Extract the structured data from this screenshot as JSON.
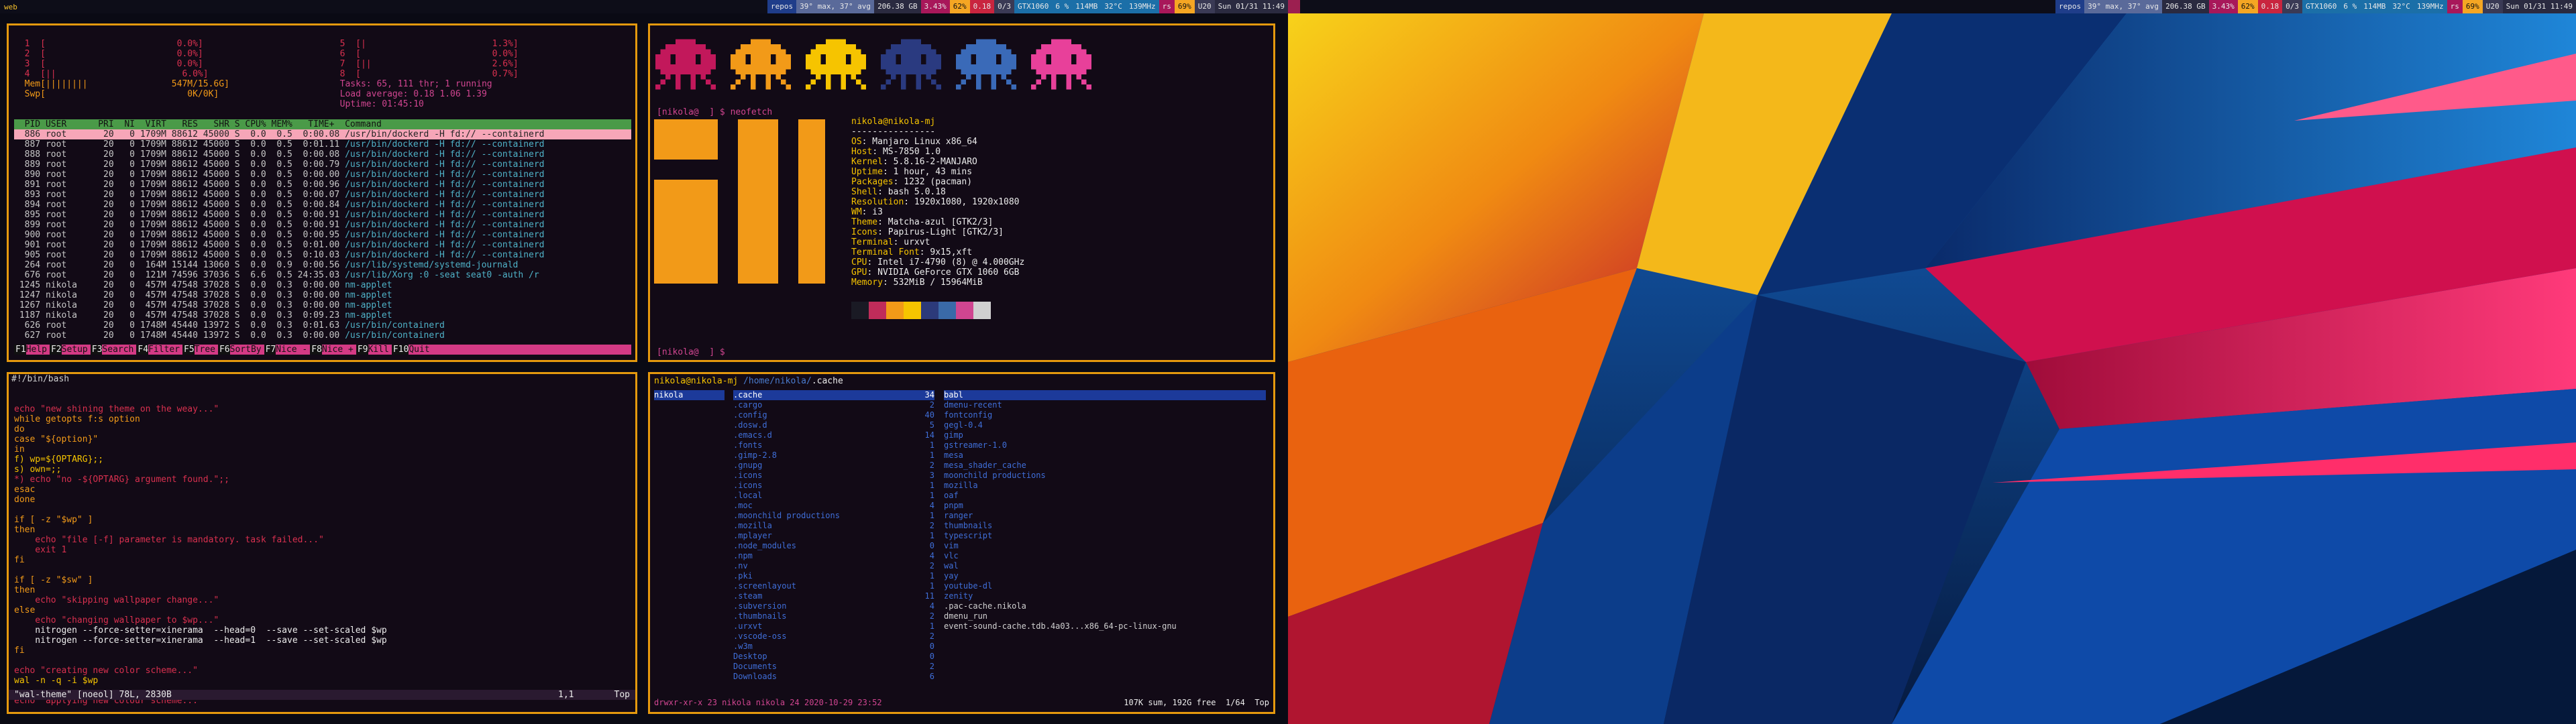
{
  "topbar_left": {
    "workspace": "web",
    "blocks": [
      "repos",
      "39° max, 37° avg",
      "206.38 GB",
      "3.43%",
      "62%",
      "0.18",
      "0/3",
      "GTX1060",
      "6 %",
      "114MB",
      "32°C",
      "139MHz",
      "rs",
      "69%",
      "U20",
      "Sun 01/31 11:49"
    ]
  },
  "topbar_right": {
    "blocks": [
      "repos",
      "39° max, 37° avg",
      "206.38 GB",
      "3.43%",
      "62%",
      "0.18",
      "0/3",
      "GTX1060",
      "6 %",
      "114MB",
      "32°C",
      "139MHz",
      "rs",
      "69%",
      "U20",
      "Sun 01/31 11:49"
    ]
  },
  "htop": {
    "cpu_left": [
      "  1  [                         0.0%]",
      "  2  [                         0.0%]",
      "  3  [                         0.0%]",
      "  4  [||                        6.0%]"
    ],
    "mem": "  Mem[||||||||                547M/15.6G]",
    "swp": "  Swp[                           0K/0K]",
    "cpu_right": [
      "  5  [|                        1.3%]",
      "  6  [                         0.0%]",
      "  7  [||                       2.6%]",
      "  8  [                         0.7%]"
    ],
    "tasks": "  Tasks: 65, 111 thr; 1 running",
    "load": "  Load average: 0.18 1.06 1.39",
    "uptime": "  Uptime: 01:45:10",
    "header": "  PID USER      PRI  NI  VIRT   RES   SHR S CPU% MEM%   TIME+  Command",
    "rows": [
      {
        "line": "  886 root       20   0 1709M 88612 45000 S  0.0  0.5  0:00.08 ",
        "cmd": "/usr/bin/dockerd -H fd:// --containerd",
        "sel": true
      },
      {
        "line": "  887 root       20   0 1709M 88612 45000 S  0.0  0.5  0:01.11 ",
        "cmd": "/usr/bin/dockerd -H fd:// --containerd"
      },
      {
        "line": "  888 root       20   0 1709M 88612 45000 S  0.0  0.5  0:00.08 ",
        "cmd": "/usr/bin/dockerd -H fd:// --containerd"
      },
      {
        "line": "  889 root       20   0 1709M 88612 45000 S  0.0  0.5  0:00.79 ",
        "cmd": "/usr/bin/dockerd -H fd:// --containerd"
      },
      {
        "line": "  890 root       20   0 1709M 88612 45000 S  0.0  0.5  0:00.00 ",
        "cmd": "/usr/bin/dockerd -H fd:// --containerd"
      },
      {
        "line": "  891 root       20   0 1709M 88612 45000 S  0.0  0.5  0:00.96 ",
        "cmd": "/usr/bin/dockerd -H fd:// --containerd"
      },
      {
        "line": "  893 root       20   0 1709M 88612 45000 S  0.0  0.5  0:00.07 ",
        "cmd": "/usr/bin/dockerd -H fd:// --containerd"
      },
      {
        "line": "  894 root       20   0 1709M 88612 45000 S  0.0  0.5  0:00.84 ",
        "cmd": "/usr/bin/dockerd -H fd:// --containerd"
      },
      {
        "line": "  895 root       20   0 1709M 88612 45000 S  0.0  0.5  0:00.91 ",
        "cmd": "/usr/bin/dockerd -H fd:// --containerd"
      },
      {
        "line": "  899 root       20   0 1709M 88612 45000 S  0.0  0.5  0:00.91 ",
        "cmd": "/usr/bin/dockerd -H fd:// --containerd"
      },
      {
        "line": "  900 root       20   0 1709M 88612 45000 S  0.0  0.5  0:00.95 ",
        "cmd": "/usr/bin/dockerd -H fd:// --containerd"
      },
      {
        "line": "  901 root       20   0 1709M 88612 45000 S  0.0  0.5  0:01.00 ",
        "cmd": "/usr/bin/dockerd -H fd:// --containerd"
      },
      {
        "line": "  905 root       20   0 1709M 88612 45000 S  0.0  0.5  0:10.03 ",
        "cmd": "/usr/bin/dockerd -H fd:// --containerd"
      },
      {
        "line": "  264 root       20   0  164M 15144 13060 S  0.0  0.9  0:00.56 ",
        "cmd": "/usr/lib/systemd/systemd-journald"
      },
      {
        "line": "  676 root       20   0  121M 74596 37036 S  6.6  0.5 24:35.03 ",
        "cmd": "/usr/lib/Xorg :0 -seat seat0 -auth /r"
      },
      {
        "line": " 1245 nikola     20   0  457M 47548 37028 S  0.0  0.3  0:00.00 ",
        "cmd": "nm-applet"
      },
      {
        "line": " 1247 nikola     20   0  457M 47548 37028 S  0.0  0.3  0:00.00 ",
        "cmd": "nm-applet"
      },
      {
        "line": " 1267 nikola     20   0  457M 47548 37028 S  0.0  0.3  0:00.00 ",
        "cmd": "nm-applet"
      },
      {
        "line": " 1187 nikola     20   0  457M 47548 37028 S  0.0  0.3  0:09.23 ",
        "cmd": "nm-applet"
      },
      {
        "line": "  626 root       20   0 1748M 45440 13972 S  0.0  0.3  0:01.63 ",
        "cmd": "/usr/bin/containerd"
      },
      {
        "line": "  627 root       20   0 1748M 45440 13972 S  0.0  0.3  0:00.00 ",
        "cmd": "/usr/bin/containerd"
      }
    ],
    "footer": [
      {
        "k": "F1",
        "l": "Help"
      },
      {
        "k": "F2",
        "l": "Setup"
      },
      {
        "k": "F3",
        "l": "Search"
      },
      {
        "k": "F4",
        "l": "Filter"
      },
      {
        "k": "F5",
        "l": "Tree"
      },
      {
        "k": "F6",
        "l": "SortBy"
      },
      {
        "k": "F7",
        "l": "Nice -"
      },
      {
        "k": "F8",
        "l": "Nice +"
      },
      {
        "k": "F9",
        "l": "Kill"
      },
      {
        "k": "F10",
        "l": "Quit"
      }
    ]
  },
  "neofetch": {
    "prompt_top": "[nikola@  ] $ neofetch",
    "user_host": "nikola@nikola-mj",
    "separator": "----------------",
    "info": [
      {
        "k": "OS",
        "v": ": Manjaro Linux x86_64"
      },
      {
        "k": "Host",
        "v": ": MS-7850 1.0"
      },
      {
        "k": "Kernel",
        "v": ": 5.8.16-2-MANJARO"
      },
      {
        "k": "Uptime",
        "v": ": 1 hour, 43 mins"
      },
      {
        "k": "Packages",
        "v": ": 1232 (pacman)"
      },
      {
        "k": "Shell",
        "v": ": bash 5.0.18"
      },
      {
        "k": "Resolution",
        "v": ": 1920x1080, 1920x1080"
      },
      {
        "k": "WM",
        "v": ": i3"
      },
      {
        "k": "Theme",
        "v": ": Matcha-azul [GTK2/3]"
      },
      {
        "k": "Icons",
        "v": ": Papirus-Light [GTK2/3]"
      },
      {
        "k": "Terminal",
        "v": ": urxvt"
      },
      {
        "k": "Terminal Font",
        "v": ": 9x15,xft"
      },
      {
        "k": "CPU",
        "v": ": Intel i7-4790 (8) @ 4.000GHz"
      },
      {
        "k": "GPU",
        "v": ": NVIDIA GeForce GTX 1060 6GB"
      },
      {
        "k": "Memory",
        "v": ": 532MiB / 15964MiB"
      }
    ],
    "palette": [
      "#1a1a24",
      "#c02c5a",
      "#f29a18",
      "#f6c400",
      "#2c3a7a",
      "#3a6aa8",
      "#d04590",
      "#d0d0d0"
    ],
    "prompt_bottom": "[nikola@  ] $ ",
    "squid_colors": [
      "#c2185b",
      "#f29a18",
      "#f6c400",
      "#2a3a80",
      "#3a6ab8",
      "#e8409a"
    ]
  },
  "vim": {
    "title": "#!/bin/bash",
    "lines": [
      {
        "t": "",
        "c": "c-wh"
      },
      {
        "t": "echo \"new shining theme on the weay...\"",
        "c": "c-red"
      },
      {
        "t": "while getopts f:s option",
        "c": "c-or"
      },
      {
        "t": "do",
        "c": "c-or"
      },
      {
        "t": "case \"${option}\"",
        "c": "c-or"
      },
      {
        "t": "in",
        "c": "c-or"
      },
      {
        "t": "f) wp=${OPTARG};;",
        "c": "c-yl"
      },
      {
        "t": "s) own=;;",
        "c": "c-yl"
      },
      {
        "t": "*) echo \"no -${OPTARG} argument found.\";;",
        "c": "c-red"
      },
      {
        "t": "esac",
        "c": "c-or"
      },
      {
        "t": "done",
        "c": "c-or"
      },
      {
        "t": "",
        "c": "c-wh"
      },
      {
        "t": "if [ -z \"$wp\" ]",
        "c": "c-or"
      },
      {
        "t": "then",
        "c": "c-or"
      },
      {
        "t": "    echo \"file [-f] parameter is mandatory. task failed...\"",
        "c": "c-red"
      },
      {
        "t": "    exit 1",
        "c": "c-red"
      },
      {
        "t": "fi",
        "c": "c-or"
      },
      {
        "t": "",
        "c": "c-wh"
      },
      {
        "t": "if [ -z \"$sw\" ]",
        "c": "c-or"
      },
      {
        "t": "then",
        "c": "c-or"
      },
      {
        "t": "    echo \"skipping wallpaper change...\"",
        "c": "c-red"
      },
      {
        "t": "else",
        "c": "c-or"
      },
      {
        "t": "    echo \"changing wallpaper to $wp...\"",
        "c": "c-red"
      },
      {
        "t": "    nitrogen --force-setter=xinerama  --head=0  --save --set-scaled $wp",
        "c": "c-wh"
      },
      {
        "t": "    nitrogen --force-setter=xinerama  --head=1  --save --set-scaled $wp",
        "c": "c-wh"
      },
      {
        "t": "fi",
        "c": "c-or"
      },
      {
        "t": "",
        "c": "c-wh"
      },
      {
        "t": "echo \"creating new color scheme...\"",
        "c": "c-red"
      },
      {
        "t": "wal -n -q -i $wp",
        "c": "c-yl"
      },
      {
        "t": "",
        "c": "c-wh"
      },
      {
        "t": "echo \"applying new colour scheme...\"",
        "c": "c-red"
      }
    ],
    "status_file": "\"wal-theme\" [noeol] 78L, 2830B",
    "status_pos": "1,1",
    "status_scroll": "Top"
  },
  "ranger": {
    "title_user": "nikola@nikola-mj",
    "title_path": " /home/nikola/",
    "title_cur": ".cache",
    "col1": [
      {
        "n": "nikola",
        "sel": true
      }
    ],
    "col2": [
      {
        "n": ".cache",
        "s": "34",
        "sel": true
      },
      {
        "n": ".cargo",
        "s": "2"
      },
      {
        "n": ".config",
        "s": "40"
      },
      {
        "n": ".dosw.d",
        "s": "5"
      },
      {
        "n": ".emacs.d",
        "s": "14"
      },
      {
        "n": ".fonts",
        "s": "1"
      },
      {
        "n": ".gimp-2.8",
        "s": "1"
      },
      {
        "n": ".gnupg",
        "s": "2"
      },
      {
        "n": ".icons",
        "s": "3"
      },
      {
        "n": ".icons",
        "s": "1"
      },
      {
        "n": ".local",
        "s": "1"
      },
      {
        "n": ".moc",
        "s": "4"
      },
      {
        "n": ".moonchild productions",
        "s": "1"
      },
      {
        "n": ".mozilla",
        "s": "2"
      },
      {
        "n": ".mplayer",
        "s": "1"
      },
      {
        "n": ".node_modules",
        "s": "0"
      },
      {
        "n": ".npm",
        "s": "4"
      },
      {
        "n": ".nv",
        "s": "2"
      },
      {
        "n": ".pki",
        "s": "1"
      },
      {
        "n": ".screenlayout",
        "s": "1"
      },
      {
        "n": ".steam",
        "s": "11"
      },
      {
        "n": ".subversion",
        "s": "4"
      },
      {
        "n": ".thumbnails",
        "s": "2"
      },
      {
        "n": ".urxvt",
        "s": "1"
      },
      {
        "n": ".vscode-oss",
        "s": "2"
      },
      {
        "n": ".w3m",
        "s": "0"
      },
      {
        "n": "Desktop",
        "s": "0"
      },
      {
        "n": "Documents",
        "s": "2"
      },
      {
        "n": "Downloads",
        "s": "6"
      }
    ],
    "col3": [
      {
        "n": "babl",
        "sel": true
      },
      {
        "n": "dmenu-recent"
      },
      {
        "n": "fontconfig"
      },
      {
        "n": "gegl-0.4"
      },
      {
        "n": "gimp"
      },
      {
        "n": "gstreamer-1.0"
      },
      {
        "n": "mesa"
      },
      {
        "n": "mesa_shader_cache"
      },
      {
        "n": "moonchild productions"
      },
      {
        "n": "mozilla"
      },
      {
        "n": "oaf"
      },
      {
        "n": "pnpm"
      },
      {
        "n": "ranger"
      },
      {
        "n": "thumbnails"
      },
      {
        "n": "typescript"
      },
      {
        "n": "vim"
      },
      {
        "n": "vlc"
      },
      {
        "n": "wal"
      },
      {
        "n": "yay"
      },
      {
        "n": "youtube-dl"
      },
      {
        "n": "zenity"
      },
      {
        "n": ".pac-cache.nikola",
        "f": true
      },
      {
        "n": "dmenu_run",
        "f": true
      },
      {
        "n": "event-sound-cache.tdb.4a03...x86_64-pc-linux-gnu",
        "f": true
      }
    ],
    "status_left": "drwxr-xr-x 23 nikola nikola 24 2020-10-29 23:52",
    "status_right": "107K sum, 192G free  1/64  Top"
  }
}
